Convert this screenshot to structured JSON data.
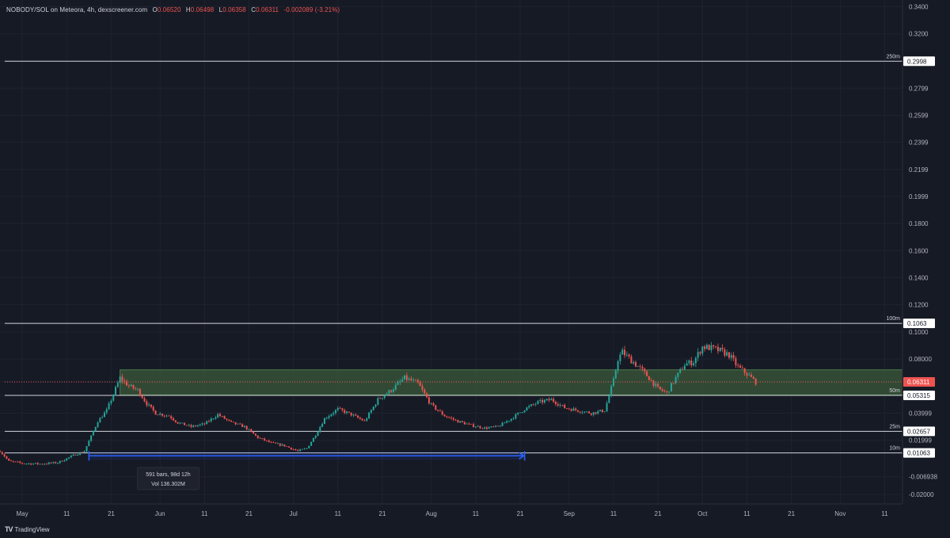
{
  "header": {
    "symbol": "NOBODY/SOL on Meteora, 4h, dexscreener.com",
    "open_label": "O",
    "open": "0.06520",
    "high_label": "H",
    "high": "0.06498",
    "low_label": "L",
    "low": "0.06358",
    "close_label": "C",
    "close": "0.06311",
    "change": "-0.002089 (-3.21%)"
  },
  "footer": {
    "brand": "TradingView"
  },
  "colors": {
    "background": "#161a25",
    "up": "#26a69a",
    "down": "#ef5350",
    "zone": "#3b5a3a",
    "measure": "#2962ff",
    "level": "#d1d4dc"
  },
  "chart_data": {
    "type": "candlestick",
    "symbol": "NOBODY/SOL",
    "interval": "4h",
    "ylim": [
      -0.027,
      0.345
    ],
    "y_ticks": [
      "0.3400",
      "0.3200",
      "0.2998",
      "0.2799",
      "0.2599",
      "0.2399",
      "0.2199",
      "0.1999",
      "0.1800",
      "0.1600",
      "0.1400",
      "0.1200",
      "0.1063",
      "0.1000",
      "0.08000",
      "0.06311",
      "0.05315",
      "0.03999",
      "0.02657",
      "0.01999",
      "0.01063",
      "-0.006938",
      "-0.02000"
    ],
    "y_tick_values": [
      0.34,
      0.32,
      0.2998,
      0.2799,
      0.2599,
      0.2399,
      0.2199,
      0.1999,
      0.18,
      0.16,
      0.14,
      0.12,
      0.1063,
      0.1,
      0.08,
      0.06311,
      0.05315,
      0.03999,
      0.02657,
      0.01999,
      0.01063,
      -0.006938,
      -0.02
    ],
    "x_ticks": [
      "May",
      "11",
      "21",
      "Jun",
      "11",
      "21",
      "Jul",
      "11",
      "21",
      "Aug",
      "11",
      "21",
      "Sep",
      "11",
      "21",
      "Oct",
      "11",
      "21",
      "Nov",
      "11"
    ],
    "x_tick_days": [
      0,
      10,
      20,
      31,
      41,
      51,
      61,
      71,
      81,
      92,
      102,
      112,
      123,
      133,
      143,
      153,
      163,
      173,
      184,
      194
    ],
    "x_range_days": [
      -5,
      198
    ],
    "levels": [
      {
        "label": "250m",
        "value": 0.2998
      },
      {
        "label": "100m",
        "value": 0.1063
      },
      {
        "label": "50m",
        "value": 0.05315
      },
      {
        "label": "25m",
        "value": 0.02657
      },
      {
        "label": "10m",
        "value": 0.01063
      }
    ],
    "last_price": "0.06311",
    "last_price_value": 0.06311,
    "zone": {
      "from_day": 22,
      "to_day": 198,
      "low": 0.0535,
      "high": 0.072
    },
    "measure": {
      "from_day": 15,
      "to_day": 113,
      "value": 0.0085,
      "line1": "591 bars, 98d 12h",
      "line2": "Vol 136.302M"
    },
    "price_path": [
      [
        -5,
        0.012
      ],
      [
        -3,
        0.0045
      ],
      [
        0,
        0.003
      ],
      [
        4,
        0.0025
      ],
      [
        8,
        0.0035
      ],
      [
        12,
        0.0095
      ],
      [
        14,
        0.012
      ],
      [
        17,
        0.034
      ],
      [
        19,
        0.042
      ],
      [
        21,
        0.058
      ],
      [
        22,
        0.066
      ],
      [
        24,
        0.06
      ],
      [
        26,
        0.057
      ],
      [
        28,
        0.047
      ],
      [
        30,
        0.04
      ],
      [
        33,
        0.038
      ],
      [
        35,
        0.033
      ],
      [
        38,
        0.03
      ],
      [
        41,
        0.032
      ],
      [
        44,
        0.039
      ],
      [
        47,
        0.033
      ],
      [
        50,
        0.03
      ],
      [
        53,
        0.022
      ],
      [
        56,
        0.018
      ],
      [
        59,
        0.016
      ],
      [
        62,
        0.012
      ],
      [
        64,
        0.014
      ],
      [
        66,
        0.024
      ],
      [
        68,
        0.036
      ],
      [
        71,
        0.043
      ],
      [
        74,
        0.039
      ],
      [
        77,
        0.034
      ],
      [
        80,
        0.05
      ],
      [
        83,
        0.057
      ],
      [
        86,
        0.066
      ],
      [
        89,
        0.062
      ],
      [
        92,
        0.046
      ],
      [
        95,
        0.038
      ],
      [
        98,
        0.034
      ],
      [
        101,
        0.031
      ],
      [
        104,
        0.029
      ],
      [
        107,
        0.03
      ],
      [
        110,
        0.036
      ],
      [
        113,
        0.043
      ],
      [
        116,
        0.048
      ],
      [
        119,
        0.05
      ],
      [
        122,
        0.044
      ],
      [
        125,
        0.042
      ],
      [
        128,
        0.04
      ],
      [
        131,
        0.042
      ],
      [
        133,
        0.064
      ],
      [
        134,
        0.08
      ],
      [
        135,
        0.085
      ],
      [
        137,
        0.079
      ],
      [
        139,
        0.073
      ],
      [
        141,
        0.066
      ],
      [
        143,
        0.058
      ],
      [
        145,
        0.055
      ],
      [
        147,
        0.066
      ],
      [
        149,
        0.076
      ],
      [
        151,
        0.078
      ],
      [
        153,
        0.089
      ],
      [
        155,
        0.088
      ],
      [
        157,
        0.086
      ],
      [
        159,
        0.083
      ],
      [
        161,
        0.074
      ],
      [
        163,
        0.069
      ],
      [
        165,
        0.063
      ]
    ]
  }
}
